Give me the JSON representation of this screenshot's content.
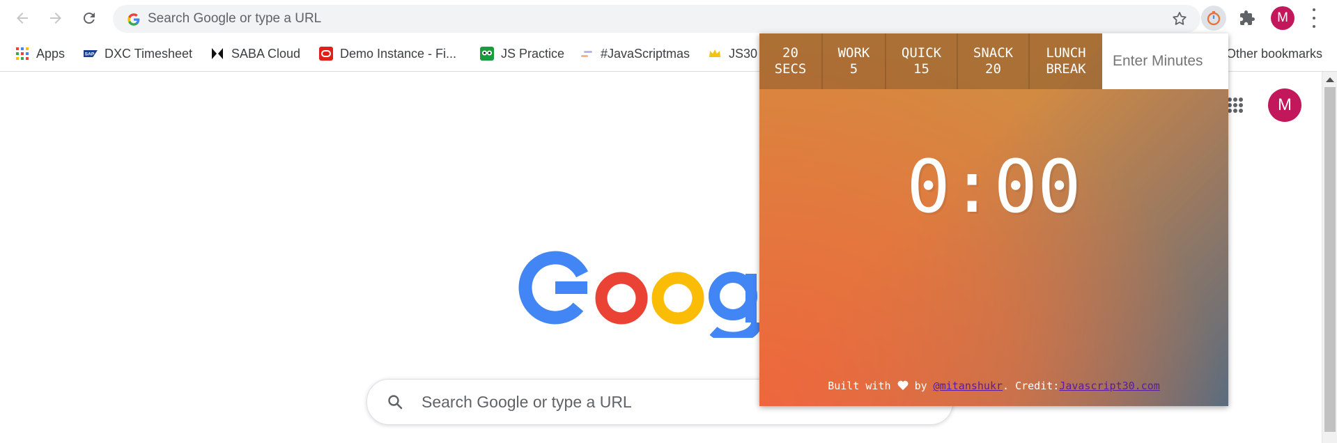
{
  "browser": {
    "omnibox_placeholder": "Search Google or type a URL",
    "profile_initial": "M"
  },
  "bookmarks": [
    {
      "label": "Apps",
      "icon": "apps-grid-icon"
    },
    {
      "label": "DXC Timesheet",
      "icon": "sap-icon"
    },
    {
      "label": "SABA Cloud",
      "icon": "saba-icon"
    },
    {
      "label": "Demo Instance - Fi...",
      "icon": "oracle-icon"
    },
    {
      "label": "JS Practice",
      "icon": "owl-icon"
    },
    {
      "label": "#JavaScriptmas",
      "icon": "scrimba-icon"
    },
    {
      "label": "JS30",
      "icon": "crown-icon"
    },
    {
      "label": "Other bookmarks",
      "icon": "folder-icon"
    }
  ],
  "google_page": {
    "search_placeholder": "Search Google or type a URL",
    "profile_initial": "M"
  },
  "timer_popup": {
    "buttons": [
      {
        "line1": "20",
        "line2": "SECS"
      },
      {
        "line1": "WORK",
        "line2": "5"
      },
      {
        "line1": "QUICK",
        "line2": "15"
      },
      {
        "line1": "SNACK",
        "line2": "20"
      },
      {
        "line1": "LUNCH",
        "line2": "BREAK"
      }
    ],
    "minutes_placeholder": "Enter Minutes",
    "display": "0:00",
    "footer": {
      "built_with": "Built with",
      "by": "by",
      "author_link": "@mitanshukr",
      "credit_label": ". Credit:",
      "credit_link": "Javascript30.com"
    }
  },
  "colors": {
    "accent_profile": "#c2185b",
    "link_purple": "#5a1b9c"
  }
}
